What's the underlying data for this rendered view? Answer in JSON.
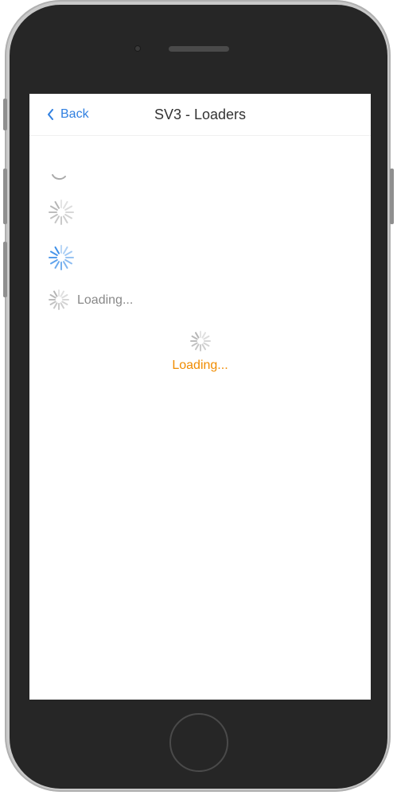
{
  "navbar": {
    "back_label": "Back",
    "title": "SV3 - Loaders"
  },
  "loaders": {
    "inline_label": "Loading...",
    "centered_label": "Loading..."
  },
  "colors": {
    "accent_blue": "#2f7fe0",
    "spinner_gray": "#b5b5b5",
    "spinner_blue": "#3d8fe8",
    "label_gray": "#888888",
    "label_orange": "#f08c00"
  }
}
